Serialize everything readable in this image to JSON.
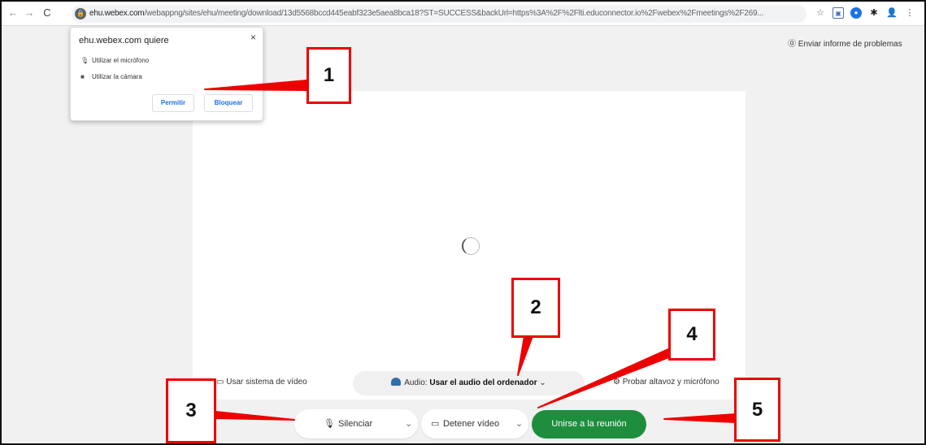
{
  "browser": {
    "url_host": "ehu.webex.com",
    "url_rest": "/webappng/sites/ehu/meeting/download/13d5568bccd445eabf323e5aea8bca18?ST=SUCCESS&backUrl=https%3A%2F%2Flti.educonnector.io%2Fwebex%2Fmeetings%2F269..."
  },
  "report_link": "Enviar informe de problemas",
  "permission_popup": {
    "title": "ehu.webex.com quiere",
    "close": "×",
    "microphone": "Utilizar el micrófono",
    "camera": "Utilizar la cámara",
    "allow": "Permitir",
    "block": "Bloquear"
  },
  "card": {
    "video_system": "Usar sistema de vídeo",
    "audio_prefix": "Audio:",
    "audio_value": "Usar el audio del ordenador",
    "test_audio": "Probar altavoz y micrófono"
  },
  "bottom_bar": {
    "mute": "Silenciar",
    "stop_video": "Detener vídeo",
    "join": "Unirse a la reunión"
  },
  "callouts": [
    "1",
    "2",
    "3",
    "4",
    "5"
  ],
  "colors": {
    "join_green": "#1e8e3e",
    "callout_red": "#e00000",
    "link_blue": "#1a73e8"
  }
}
